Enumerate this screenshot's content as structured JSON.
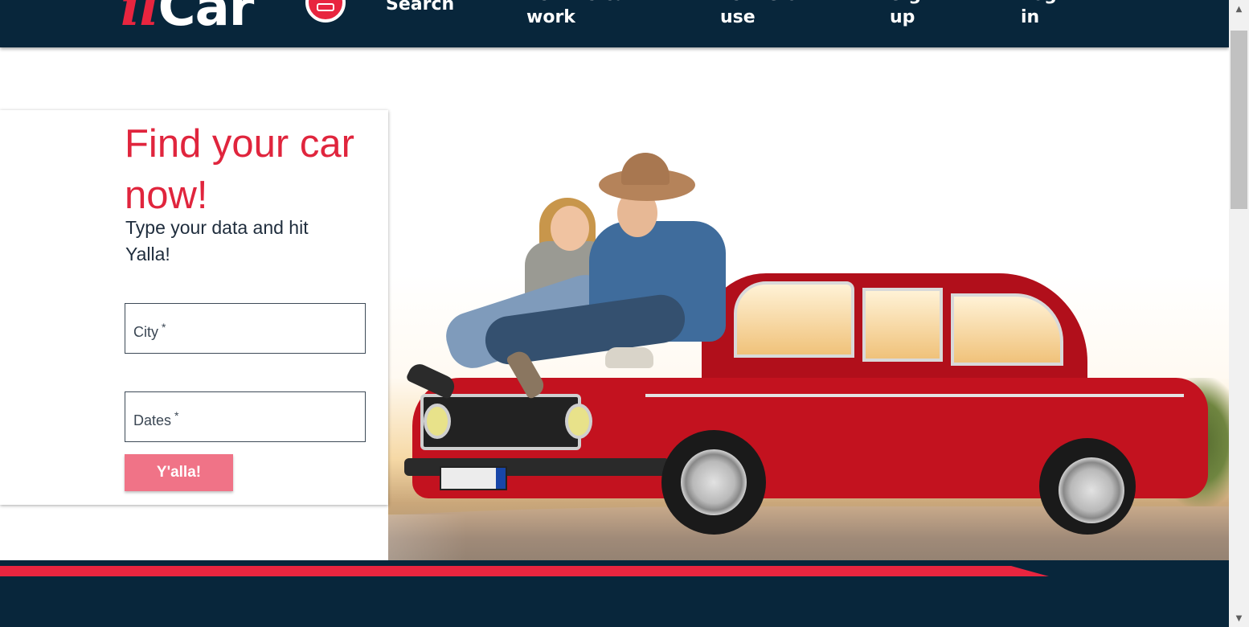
{
  "header": {
    "brand_prefix": "il",
    "brand_main": "Car",
    "nav": [
      {
        "label": "Search"
      },
      {
        "label": "Let the car work"
      },
      {
        "label": "Terms of use"
      },
      {
        "label": "Sign up"
      },
      {
        "label": "Log in"
      }
    ]
  },
  "search_card": {
    "title": "Find your car now!",
    "subtitle": "Type your data and hit Yalla!",
    "city_label": "City",
    "dates_label": "Dates",
    "required_mark": "*",
    "submit_label": "Y'alla!"
  },
  "colors": {
    "navy": "#08263b",
    "brand_red": "#e8253f",
    "button_pink": "#f07387"
  }
}
